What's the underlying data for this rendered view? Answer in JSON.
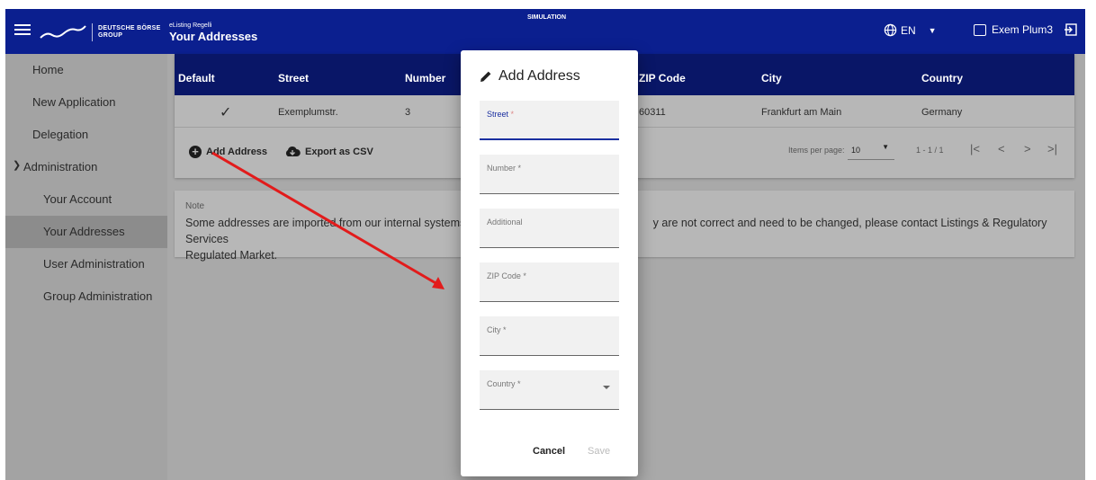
{
  "topbar": {
    "logo_line1": "DEUTSCHE BÖRSE",
    "logo_line2": "GROUP",
    "app_subtitle": "eListing Regelli",
    "page_title": "Your Addresses",
    "environment": "SIMULATION",
    "language": "EN",
    "user_name": "Exem Plum3"
  },
  "sidebar": {
    "items": [
      {
        "label": "Home"
      },
      {
        "label": "New Application"
      },
      {
        "label": "Delegation"
      },
      {
        "label": "Administration",
        "expanded": true
      },
      {
        "label": "Your Account"
      },
      {
        "label": "Your Addresses",
        "active": true
      },
      {
        "label": "User Administration"
      },
      {
        "label": "Group Administration"
      }
    ]
  },
  "table": {
    "columns": [
      "Default",
      "Street",
      "Number",
      "ZIP Code",
      "City",
      "Country"
    ],
    "rows": [
      {
        "default": "✓",
        "street": "Exemplumstr.",
        "number": "3",
        "zip": "60311",
        "city": "Frankfurt am Main",
        "country": "Germany"
      }
    ],
    "add_address_label": "Add Address",
    "export_label": "Export as CSV",
    "items_per_page_label": "Items per page:",
    "items_per_page_value": "10",
    "range_label": "1 - 1 / 1"
  },
  "note": {
    "title": "Note",
    "text_left": "Some addresses are imported from our internal systems a",
    "text_right": "y are not correct and need to be changed, please contact Listings & Regulatory Services",
    "text_line2": "Regulated Market."
  },
  "dialog": {
    "title": "Add Address",
    "fields": [
      {
        "label": "Street",
        "required_mark": "*",
        "value": ""
      },
      {
        "label": "Number *",
        "value": ""
      },
      {
        "label": "Additional",
        "value": ""
      },
      {
        "label": "ZIP Code *",
        "value": ""
      },
      {
        "label": "City *",
        "value": ""
      },
      {
        "label": "Country *",
        "value": ""
      }
    ],
    "cancel_label": "Cancel",
    "save_label": "Save"
  },
  "colors": {
    "header_blue": "#0b1f8f",
    "focus_blue": "#1a2fa0",
    "arrow_red": "#e21b1b"
  }
}
